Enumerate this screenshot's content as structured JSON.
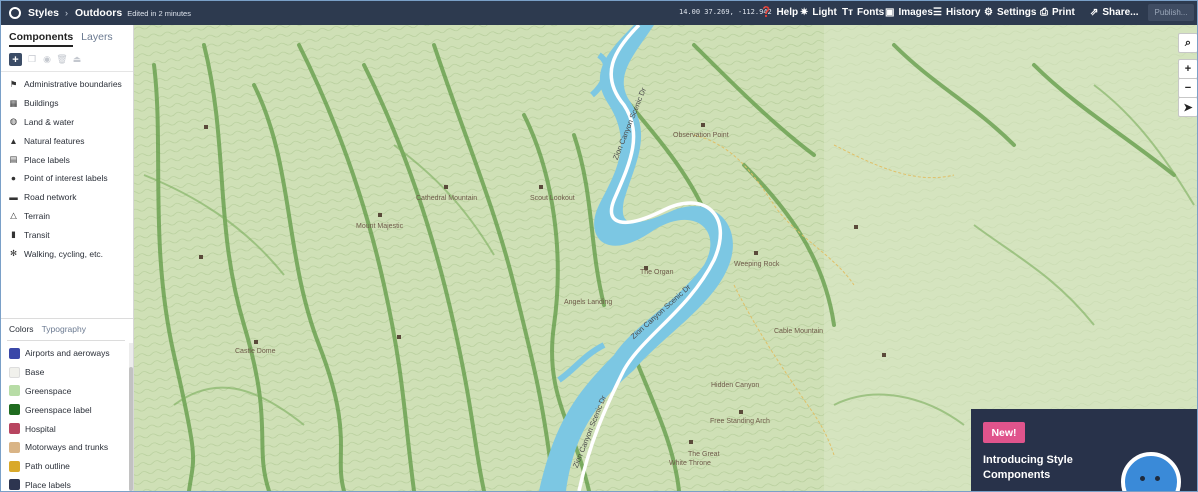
{
  "topbar": {
    "breadcrumb_root": "Styles",
    "breadcrumb_sep": "›",
    "style_name": "Outdoors",
    "edited_text": "Edited in 2 minutes",
    "coords": "14.00  37.269, -112.942",
    "help": "Help",
    "light": "Light",
    "fonts": "Fonts",
    "images": "Images",
    "history": "History",
    "settings": "Settings",
    "print": "Print",
    "share": "Share...",
    "publish": "Publish..."
  },
  "sidebar": {
    "tabs": [
      "Components",
      "Layers"
    ],
    "components": [
      {
        "label": "Administrative boundaries",
        "icon": "flag-icon"
      },
      {
        "label": "Buildings",
        "icon": "building-icon"
      },
      {
        "label": "Land & water",
        "icon": "globe-icon"
      },
      {
        "label": "Natural features",
        "icon": "mountain-icon"
      },
      {
        "label": "Place labels",
        "icon": "place-label-icon"
      },
      {
        "label": "Point of interest labels",
        "icon": "pin-icon"
      },
      {
        "label": "Road network",
        "icon": "car-icon"
      },
      {
        "label": "Terrain",
        "icon": "terrain-icon"
      },
      {
        "label": "Transit",
        "icon": "bus-icon"
      },
      {
        "label": "Walking, cycling, etc.",
        "icon": "walker-icon"
      }
    ],
    "subtabs": [
      "Colors",
      "Typography"
    ],
    "colors": [
      {
        "label": "Airports and aeroways",
        "color": "#3a47a8"
      },
      {
        "label": "Base",
        "color": "#f1f1ec"
      },
      {
        "label": "Greenspace",
        "color": "#b7dca6"
      },
      {
        "label": "Greenspace label",
        "color": "#1f6b1f"
      },
      {
        "label": "Hospital",
        "color": "#b84560"
      },
      {
        "label": "Motorways and trunks",
        "color": "#d9b486"
      },
      {
        "label": "Path outline",
        "color": "#d9a92a"
      },
      {
        "label": "Place labels",
        "color": "#2d3550"
      }
    ]
  },
  "map": {
    "places": [
      "Observation Point",
      "Cathedral Mountain",
      "Scout Lookout",
      "Mount Majestic",
      "The Organ",
      "Weeping Rock",
      "Angels Landing",
      "Cable Mountain",
      "Castle Dome",
      "Hidden Canyon",
      "Free Standing Arch",
      "The Great",
      "White Throne"
    ],
    "roads": [
      "Zion Canyon Scenic Dr",
      "Zion Canyon Scenic Dr",
      "Zion Canyon Scenic Dr"
    ]
  },
  "promo": {
    "badge": "New!",
    "title": "Introducing Style Components"
  }
}
